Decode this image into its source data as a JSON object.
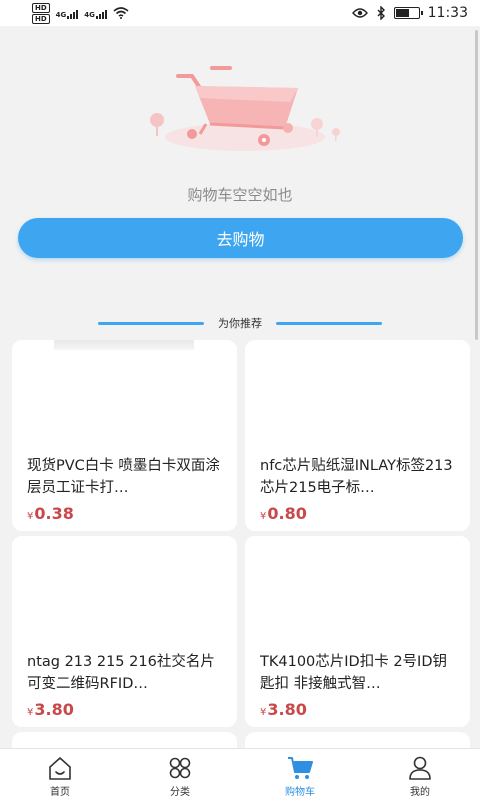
{
  "status_bar": {
    "sim1": "HD",
    "sim2": "HD",
    "net1": "4G",
    "net2": "4G",
    "time": "11:33",
    "icons": [
      "eye-icon",
      "bluetooth-icon",
      "battery-icon",
      "wifi-icon"
    ]
  },
  "empty_cart": {
    "message": "购物车空空如也",
    "button_label": "去购物"
  },
  "recommend": {
    "title": "为你推荐"
  },
  "products": [
    {
      "name": "现货PVC白卡 喷墨白卡双面涂层员工证卡打…",
      "currency": "¥",
      "price": "0.38"
    },
    {
      "name": "nfc芯片贴纸湿INLAY标签213芯片215电子标…",
      "currency": "¥",
      "price": "0.80"
    },
    {
      "name": "ntag 213 215 216社交名片 可变二维码RFID…",
      "currency": "¥",
      "price": "3.80"
    },
    {
      "name": "TK4100芯片ID扣卡 2号ID钥匙扣 非接触式智…",
      "currency": "¥",
      "price": "3.80"
    }
  ],
  "tab_bar": {
    "tabs": [
      {
        "label": "首页",
        "icon": "home-icon"
      },
      {
        "label": "分类",
        "icon": "category-icon"
      },
      {
        "label": "购物车",
        "icon": "cart-icon",
        "active": true
      },
      {
        "label": "我的",
        "icon": "profile-icon"
      }
    ]
  },
  "colors": {
    "accent": "#3ea6f0",
    "price": "#c9484a",
    "background": "#f2f2f2"
  }
}
